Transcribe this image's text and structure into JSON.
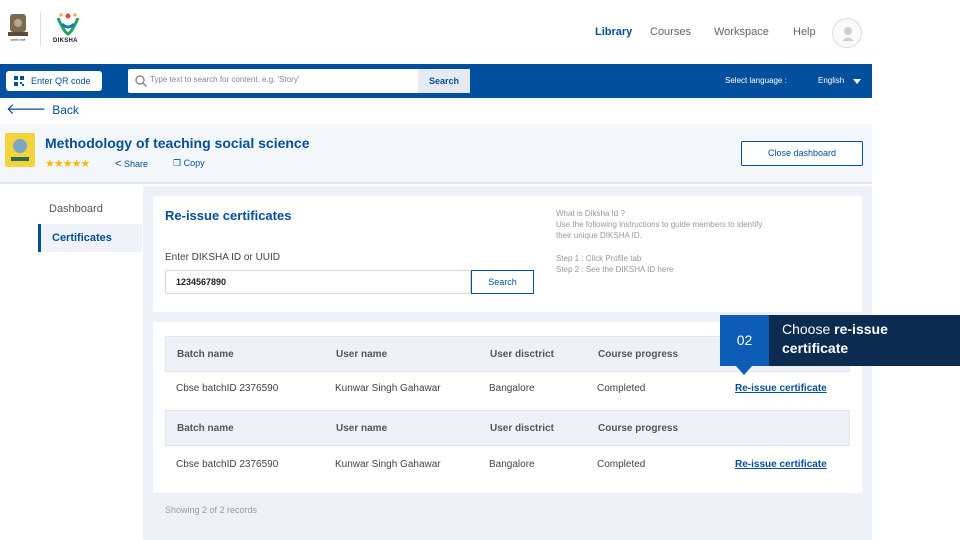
{
  "header": {
    "logo_text": "DIKSHA",
    "emblem_text": "सत्यमेव जयते",
    "nav": [
      "Library",
      "Courses",
      "Workspace",
      "Help"
    ]
  },
  "searchbar": {
    "qr_label": "Enter QR code",
    "placeholder": "Type text to search for content. e.g. 'Story'",
    "search_label": "Search",
    "language_label": "Select language :",
    "language_value": "English"
  },
  "back_label": "Back",
  "course": {
    "title": "Methodology of teaching social science",
    "rating_stars": "★★★★★",
    "share_label": "Share",
    "copy_label": "Copy",
    "close_label": "Close dashboard"
  },
  "menu": {
    "dashboard": "Dashboard",
    "certificates": "Certificates"
  },
  "form": {
    "title": "Re-issue certificates",
    "id_label": "Enter DIKSHA ID or UUID",
    "id_value": "1234567890",
    "search_label": "Search",
    "help_lines": [
      "What is Diksha Id ?",
      "Use the following instructions to guide members to identify",
      "their unique DIKSHA ID.",
      "Step 1 : Click Profile tab",
      "Step 2 : See the DIKSHA ID here"
    ]
  },
  "table": {
    "headers": [
      "Batch name",
      "User name",
      "User disctrict",
      "Course progress"
    ],
    "rows": [
      [
        "Cbse batchID 2376590",
        "Kunwar Singh Gahawar",
        "Bangalore",
        "Completed",
        "Re-issue certificate"
      ],
      [
        "Cbse batchID 2376590",
        "Kunwar Singh Gahawar",
        "Bangalore",
        "Completed",
        "Re-issue certificate"
      ]
    ]
  },
  "showing": "Showing 2 of 2 records",
  "callout": {
    "number": "02",
    "text_plain": "Choose ",
    "text_bold_1": "re-issue",
    "text_bold_2": "certificate"
  },
  "colors": {
    "primary": "#024f9d",
    "callout_dark": "#0b2c50",
    "callout_accent": "#0d5db7",
    "star": "#f5b800"
  }
}
